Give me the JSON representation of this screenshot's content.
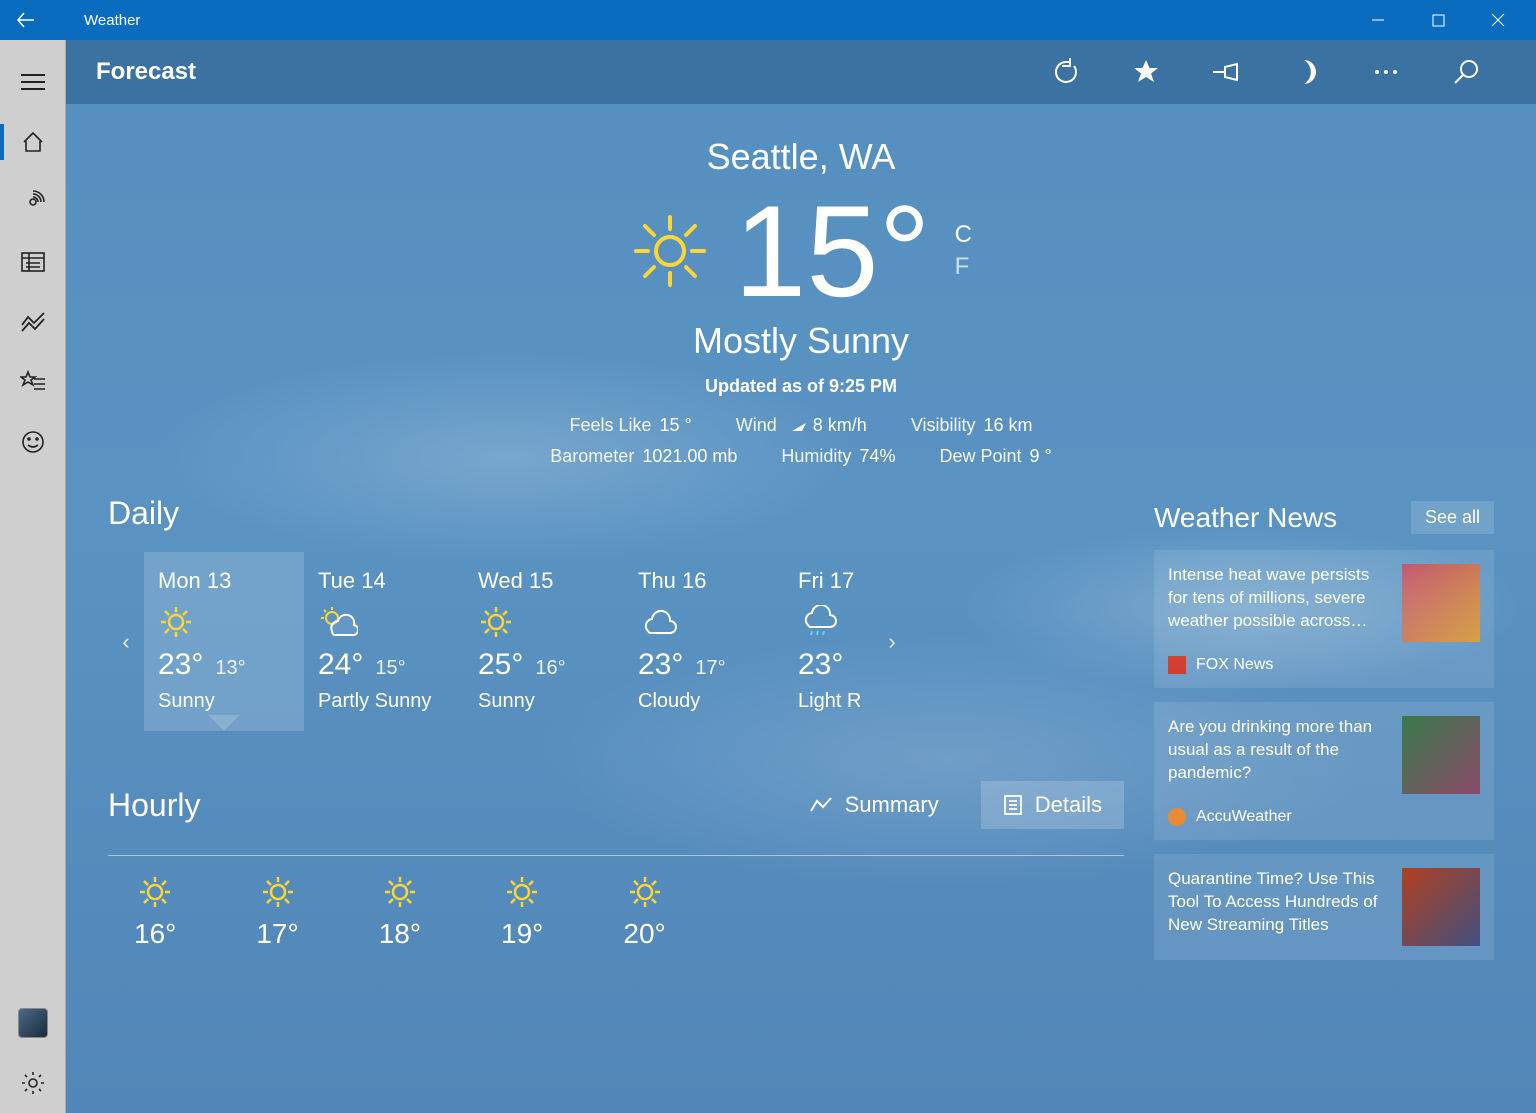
{
  "window": {
    "title": "Weather"
  },
  "header": {
    "title": "Forecast"
  },
  "hero": {
    "location": "Seattle, WA",
    "temp": "15°",
    "unit_c": "C",
    "unit_f": "F",
    "condition": "Mostly Sunny",
    "updated": "Updated as of 9:25 PM",
    "stats1": {
      "feels_lbl": "Feels Like",
      "feels_val": "15 °",
      "wind_lbl": "Wind",
      "wind_val": "8 km/h",
      "vis_lbl": "Visibility",
      "vis_val": "16 km"
    },
    "stats2": {
      "baro_lbl": "Barometer",
      "baro_val": "1021.00 mb",
      "hum_lbl": "Humidity",
      "hum_val": "74%",
      "dew_lbl": "Dew Point",
      "dew_val": "9 °"
    }
  },
  "daily": {
    "title": "Daily",
    "items": [
      {
        "name": "Mon 13",
        "hi": "23°",
        "lo": "13°",
        "cond": "Sunny",
        "icon": "sun"
      },
      {
        "name": "Tue 14",
        "hi": "24°",
        "lo": "15°",
        "cond": "Partly Sunny",
        "icon": "partly"
      },
      {
        "name": "Wed 15",
        "hi": "25°",
        "lo": "16°",
        "cond": "Sunny",
        "icon": "sun"
      },
      {
        "name": "Thu 16",
        "hi": "23°",
        "lo": "17°",
        "cond": "Cloudy",
        "icon": "cloud"
      },
      {
        "name": "Fri 17",
        "hi": "23°",
        "lo": "",
        "cond": "Light R",
        "icon": "rain"
      }
    ]
  },
  "hourly": {
    "title": "Hourly",
    "summary": "Summary",
    "details": "Details",
    "items": [
      {
        "temp": "16°"
      },
      {
        "temp": "17°"
      },
      {
        "temp": "18°"
      },
      {
        "temp": "19°"
      },
      {
        "temp": "20°"
      }
    ]
  },
  "news": {
    "title": "Weather News",
    "seeall": "See all",
    "items": [
      {
        "title": "Intense heat wave persists for tens of millions, severe weather possible across…",
        "source": "FOX News"
      },
      {
        "title": "Are you drinking more than usual as a result of the pandemic?",
        "source": "AccuWeather"
      },
      {
        "title": "Quarantine Time? Use This Tool To Access Hundreds of New Streaming Titles",
        "source": ""
      }
    ]
  }
}
